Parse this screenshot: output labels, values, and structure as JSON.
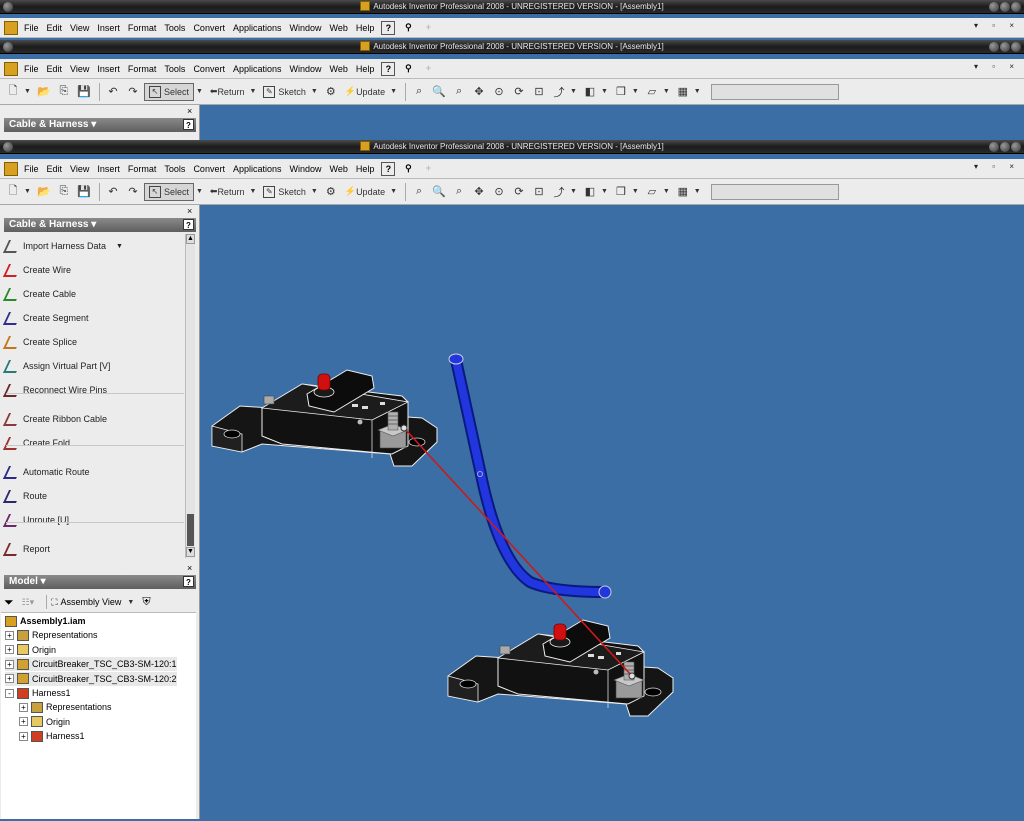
{
  "window": {
    "title": "Autodesk Inventor Professional 2008 - UNREGISTERED VERSION - [Assembly1]"
  },
  "menu": [
    "File",
    "Edit",
    "View",
    "Insert",
    "Format",
    "Tools",
    "Convert",
    "Applications",
    "Window",
    "Web",
    "Help"
  ],
  "toolbar": {
    "select_label": "Select",
    "return_label": "Return",
    "sketch_label": "Sketch",
    "update_label": "Update"
  },
  "panel_bar": {
    "title": "Cable & Harness",
    "help": "?",
    "items": [
      {
        "label": "Import Harness Data",
        "icon": "import-harness-icon",
        "color": "#555555"
      },
      {
        "label": "Create Wire",
        "icon": "wire-icon",
        "color": "#d02020"
      },
      {
        "label": "Create Cable",
        "icon": "cable-icon",
        "color": "#2a8a2a"
      },
      {
        "label": "Create Segment",
        "icon": "segment-icon",
        "color": "#303090"
      },
      {
        "label": "Create Splice",
        "icon": "splice-icon",
        "color": "#c07818"
      },
      {
        "label": "Assign Virtual Part   [V]",
        "icon": "virtual-part-icon",
        "color": "#2a7a7a"
      },
      {
        "label": "Reconnect Wire Pins",
        "icon": "reconnect-icon",
        "color": "#6a2a2a"
      },
      {
        "label": "Create Ribbon Cable",
        "icon": "ribbon-cable-icon",
        "color": "#8a3a3a"
      },
      {
        "label": "Create Fold",
        "icon": "fold-icon",
        "color": "#a03030"
      },
      {
        "label": "Automatic Route",
        "icon": "auto-route-icon",
        "color": "#2a2a8a"
      },
      {
        "label": "Route",
        "icon": "route-icon",
        "color": "#2a2a6a"
      },
      {
        "label": "Unroute   [U]",
        "icon": "unroute-icon",
        "color": "#6a2a6a"
      },
      {
        "label": "Report",
        "icon": "report-icon",
        "color": "#7a2a2a"
      }
    ]
  },
  "model_browser": {
    "title": "Model",
    "help": "?",
    "view_label": "Assembly View",
    "tree": [
      {
        "label": "Assembly1.iam",
        "level": 0,
        "bold": true,
        "expander": "",
        "icon": "assembly-icon"
      },
      {
        "label": "Representations",
        "level": 1,
        "expander": "+",
        "icon": "representations-icon"
      },
      {
        "label": "Origin",
        "level": 1,
        "expander": "+",
        "icon": "folder-icon"
      },
      {
        "label": "CircuitBreaker_TSC_CB3-SM-120:1",
        "level": 1,
        "expander": "+",
        "icon": "part-icon"
      },
      {
        "label": "CircuitBreaker_TSC_CB3-SM-120:2",
        "level": 1,
        "expander": "+",
        "icon": "part-icon"
      },
      {
        "label": "Harness1",
        "level": 1,
        "expander": "-",
        "icon": "harness-icon"
      },
      {
        "label": "Representations",
        "level": 2,
        "expander": "+",
        "icon": "representations-icon"
      },
      {
        "label": "Origin",
        "level": 2,
        "expander": "+",
        "icon": "folder-icon"
      },
      {
        "label": "Harness1",
        "level": 2,
        "expander": "+",
        "icon": "harness-icon"
      }
    ]
  },
  "colors": {
    "viewport": "#3a6ea5",
    "wire": "#cc1a1a",
    "segment": "#1a2ad0",
    "part_body": "#1a1a1a"
  }
}
